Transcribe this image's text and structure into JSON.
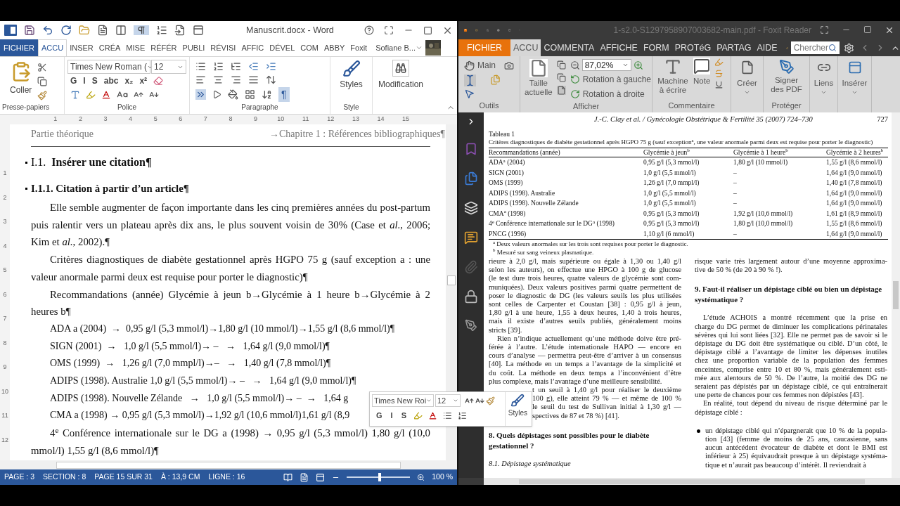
{
  "word": {
    "title": "Manuscrit.docx - Word",
    "tabs": [
      {
        "label": "FICHIER",
        "kind": "file",
        "selected": false
      },
      {
        "label": "ACCU",
        "kind": "tab",
        "selected": true
      },
      {
        "label": "INSER",
        "kind": "tab",
        "selected": false
      },
      {
        "label": "CRÉA",
        "kind": "tab",
        "selected": false
      },
      {
        "label": "MISE",
        "kind": "tab",
        "selected": false
      },
      {
        "label": "RÉFÉR",
        "kind": "tab",
        "selected": false
      },
      {
        "label": "PUBLI",
        "kind": "tab",
        "selected": false
      },
      {
        "label": "RÉVISI",
        "kind": "tab",
        "selected": false
      },
      {
        "label": "AFFIC",
        "kind": "tab",
        "selected": false
      },
      {
        "label": "DÉVEL",
        "kind": "tab",
        "selected": false
      },
      {
        "label": "COM",
        "kind": "tab",
        "selected": false
      },
      {
        "label": "ABBY",
        "kind": "tab",
        "selected": false
      },
      {
        "label": "Foxit",
        "kind": "tab",
        "selected": false
      }
    ],
    "user": "Sofiane B...",
    "ribbon": {
      "paste": "Coller",
      "font": "Times New Roman (",
      "size": "12",
      "font_buttons": [
        "G",
        "I",
        "S",
        "abc",
        "x₂",
        "x²"
      ],
      "show_marks": {
        "label": "¶",
        "on": true
      },
      "styles": "Styles",
      "editing": "Modification",
      "groups": [
        "Presse-papiers",
        "Police",
        "Paragraphe",
        "Style"
      ]
    },
    "ruler": [
      "1",
      "2",
      "3",
      "4",
      "5",
      "6",
      "7",
      "8",
      "9",
      "10",
      "11",
      "12",
      "13",
      "14",
      "15"
    ],
    "vruler": [
      "1",
      "2",
      "3",
      "4",
      "5",
      "6",
      "7",
      "8",
      "9",
      "10",
      "11",
      "12"
    ],
    "header": {
      "left": "Partie théorique",
      "tab": "→",
      "right": "Chapitre 1 : Références bibliographiques¶"
    },
    "heading1": {
      "number": "I.1.",
      "text": "Insérer une citation¶"
    },
    "heading2": "I.1.1. Citation à partir d’un article¶",
    "paragraphs": [
      {
        "kind": "body",
        "text": "Elle semble augmenter de façon importante dans les cinq premières années du post-partum puis ralentir vers un plateau après dix ans, le plus souvent voisin de 30% (Case et *al.*, 2006; Kim et *al.*, 2002).¶"
      },
      {
        "kind": "body",
        "text": "Critères diagnostiques de diabète gestationnel après HGPO 75 g (sauf exception a : une valeur anormale parmi deux est requise pour porter le diagnostic)¶"
      },
      {
        "kind": "body",
        "text": "Recommandations (année) Glycémie à jeun b→Glycémie à 1 heure b→Glycémie à 2 heures b¶"
      },
      {
        "kind": "line",
        "text": "ADA a (2004)  →  0,95 g/l (5,3 mmol/l)→1,80 g/l (10 mmol/l)→1,55 g/l (8,6 mmol/l)¶"
      },
      {
        "kind": "line",
        "text": "SIGN (2001)  →   1,0 g/l (5,5 mmol/l)→ –   →   1,64 g/l (9,0 mmol/l)¶"
      },
      {
        "kind": "line",
        "text": "OMS (1999)  →   1,26 g/l (7,0 mmpl/l)→–   →   1,40 g/l (7,8 mmol/l)¶"
      },
      {
        "kind": "line",
        "text": "ADIPS (1998). Australie 1,0 g/l (5,5 mmol/l)→ –   →   1,64 g/l (9,0 mmol/l)¶"
      },
      {
        "kind": "line",
        "text": "ADIPS (1998). Nouvelle Zélande   →   1,0 g/l (5,5 mmol/l)→ –  →   1,64 g"
      },
      {
        "kind": "line",
        "text": "CMA a (1998) → 0,95 g/l (5,3 mmol/l)→1,92 g/l (10,6 mmol/l)1,61 g/l (8,9"
      },
      {
        "kind": "body",
        "text": "4$^{e}$ Conférence internationale sur le DG a (1998)   →   0,95 g/l (5,3 mmol/l) 1,80 g/l (10,0 mmol/l) 1,55 g/l (8,6 mmol/l)¶"
      }
    ],
    "status": [
      "PAGE : 3",
      "SECTION : 8",
      "PAGE 15 SUR 31",
      "À : 13,9 CM",
      "LIGNE : 16"
    ],
    "zoom": {
      "level": 0.5,
      "reading": "100 %"
    }
  },
  "foxit": {
    "title": "1-s2.0-S1297958907003682-main.pdf - Foxit Reader",
    "tabs": [
      {
        "label": "FICHIER",
        "kind": "file",
        "selected": false
      },
      {
        "label": "ACCU",
        "kind": "tab",
        "selected": true
      },
      {
        "label": "COMMENTA",
        "kind": "tab",
        "selected": false
      },
      {
        "label": "AFFICHE",
        "kind": "tab",
        "selected": false
      },
      {
        "label": "FORM",
        "kind": "tab",
        "selected": false
      },
      {
        "label": "PROTéG",
        "kind": "tab",
        "selected": false
      },
      {
        "label": "PARTAG",
        "kind": "tab",
        "selected": false
      },
      {
        "label": "AIDE",
        "kind": "tab",
        "selected": false
      }
    ],
    "search": {
      "placeholder": "Chercher"
    },
    "ribbon": {
      "hand": "Main",
      "actual_size": "Taille actuelle",
      "zoom": "87,02%",
      "rotate_left": "Rotation à gauche",
      "rotate_right": "Rotation à droite",
      "typewriter": "Machine à écrire",
      "note": "Note",
      "create": "Créer",
      "sign": "Signer des PDF",
      "links": "Liens",
      "insert": "Insérer",
      "groups": [
        "Outils",
        "Afficher",
        "Commentaire",
        "Protéger"
      ]
    },
    "page": {
      "running_head": "J.-C. Clay et al. / Gynécologie Obstétrique & Fertilité 35 (2007) 724–730",
      "page_number": "727",
      "table": {
        "label": "Tableau 1",
        "caption": "Critères diagnostiques de diabète gestationnel après HGPO 75 g (sauf exception$^{a}$, une valeur anormale parmi deux est requise pour porter le diagnostic)",
        "columns": [
          "Recommandations (année)",
          "Glycémie à jeun$^{b}$",
          "Glycémie à 1 heure$^{b}$",
          "Glycémie à 2 heures$^{b}$"
        ],
        "rows": [
          [
            "ADA$^{a}$ (2004)",
            "0,95 g/l (5,3 mmol/l)",
            "1,80 g/l (10 mmol/l)",
            "1,55 g/l (8,6 mmol/l)"
          ],
          [
            "SIGN (2001)",
            "1,0 g/l (5,5 mmol/l)",
            "–",
            "1,64 g/l (9,0 mmol/l)"
          ],
          [
            "OMS (1999)",
            "1,26 g/l (7,0 mmpl/l)",
            "–",
            "1,40 g/l (7,8 mmol/l)"
          ],
          [
            "ADIPS (1998). Australie",
            "1,0 g/l (5,5 mmol/l)",
            "–",
            "1,64 g/l (9,0 mmol/l)"
          ],
          [
            "ADIPS (1998). Nouvelle Zélande",
            "1,0 g/l (5,5 mmol/l)",
            "–",
            "1,64 g/l (9,0 mmol/l)"
          ],
          [
            "CMA$^{a}$ (1998)",
            "0,95 g/l (5,3 mmol/l)",
            "1,92 g/l (10,6 mmol/l)",
            "1,61 g/l (8,9 mmol/l)"
          ],
          [
            "4$^{e}$ Conférence internationale sur le DG$^{a}$ (1998)",
            "0,95 g/l (5,3 mmol/l)",
            "1,80 g/l (10,0 mmol/l)",
            "1,55 g/l (8,6 mmol/l)"
          ],
          [
            "PNCG (1996)",
            "1,10 g/l (6 mmol/l)",
            "–",
            "1,64 g/l (9,0 mmol/l)"
          ]
        ],
        "footnotes": [
          "$^{a}$ Deux valeurs anormales sur les trois sont requises pour porter le diagnostic.",
          "$^{b}$ Mesuré sur sang veineux plasmatique."
        ]
      },
      "columns": [
        [
          {
            "kind": "para",
            "indent": false,
            "occluded": false,
            "lines": [
              "rieure à 2,0 g/l, mais supérieure ou égale à 1,30 ou 1,40 g/l",
              "selon les auteurs), on effectue une HPGO à 100 g de glucose",
              "(le test dure trois heures, quatre valeurs de glycémie sont com-",
              "muniquées). Deux valeurs positives parmi quatre permettent de",
              "poser le diagnostic de DG (les valeurs seuils les plus utilisées",
              "sont celles de Carpenter et Coustan [38] : 0,95 g/l à jeun,",
              "1,80 g/l à une heure, 1,55 à deux heures, 1,40 à trois heures,",
              "mais il existe d’autres seuils publiés, généralement moins",
              "stricts [39]."
            ]
          },
          {
            "kind": "para",
            "indent": true,
            "occluded": false,
            "lines": [
              "Rien n’indique actuellement qu’une méthode doive être pré-",
              "férée à l’autre. L’étude internationale HAPO — encore en",
              "cours d’analyse — permettra peut-être d’arriver à un consensus",
              "[40]. La méthode en un temps a l’avantage de la simplicité et",
              "du coût. La méthode en deux temps a l’inconvénient d’être",
              "plus complexe, mais l’avantage d’une meilleure sensibilité."
            ]
          },
          {
            "kind": "para",
            "indent": false,
            "occluded": true,
            "lines": [
              "t un seuil à 1,40 g/l pour réaliser le deuxième",
              "100 g), elle atteint 79 % — et même de 100 %",
              "le seuil du test de Sullivan initial à 1,30 g/l —",
              "spectives de 87 et 78 %) [41]."
            ]
          },
          {
            "kind": "heading",
            "indent": false,
            "occluded": false,
            "lines": [
              "8. Quels dépistages sont possibles pour le diabète",
              "gestationnel ?"
            ]
          },
          {
            "kind": "subheading",
            "indent": false,
            "occluded": false,
            "lines": [
              "8.1. Dépistage systématique"
            ]
          }
        ],
        [
          {
            "kind": "para",
            "indent": false,
            "occluded": false,
            "lines": [
              "risque varie très largement autour d’une moyenne approxima-",
              "tive de 50 % (de 20 à 90 % !)."
            ]
          },
          {
            "kind": "heading",
            "indent": false,
            "occluded": false,
            "lines": [
              "9. Faut-il réaliser un dépistage ciblé ou bien un dépistage",
              "systématique ?"
            ]
          },
          {
            "kind": "para",
            "indent": true,
            "occluded": false,
            "lines": [
              "L’étude ACHOIS a montré récemment que la prise en",
              "charge du DG permet de diminuer les complications périnatales",
              "sévères qui lui sont liées [32]. Elle ne permet pas de savoir si le",
              "dépistage du DG doit être systématique ou ciblé. D’un côté, le",
              "dépistage ciblé a l’avantage de limiter les dépenses inutiles",
              "chez une proportion variable de la population des femmes",
              "enceintes, comprise entre 10 et 80 %, mais généralement esti-",
              "mée aux alentours de 50 %. De l’autre, la moitié des DG ne",
              "seraient pas dépistés par un dépistage ciblé, ce qui entraînerait",
              "une perte de chances pour ces femmes non dépistées [43]."
            ]
          },
          {
            "kind": "para",
            "indent": true,
            "occluded": false,
            "lines": [
              "En réalité, tout dépend du niveau de risque déterminé par le",
              "dépistage ciblé :"
            ]
          },
          {
            "kind": "bullet",
            "indent": false,
            "occluded": false,
            "lines": [
              "un dépistage ciblé qui n’épargnerait que 10 % de la popula-",
              "tion [43] (femme de moins de 25 ans, caucasienne, sans",
              "aucun antécédent évocateur de diabète et dont le BMI est",
              "inférieur à 25) équivaudrait presque à un dépistage systéma-",
              "tique et n’aurait pas beaucoup d’intérêt. Il reviendrait à"
            ]
          }
        ]
      ]
    }
  },
  "mini_toolbar": {
    "font": "Times New Roi",
    "size": "12",
    "buttons": [
      "G",
      "I",
      "S"
    ],
    "styles": "Styles"
  }
}
